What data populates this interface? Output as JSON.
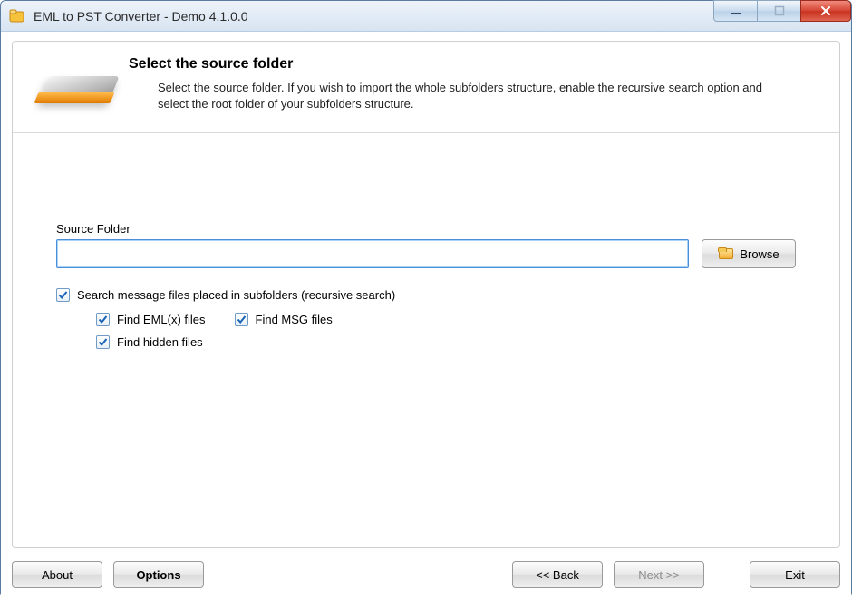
{
  "window": {
    "title": "EML to PST Converter - Demo 4.1.0.0"
  },
  "header": {
    "title": "Select the source folder",
    "description": "Select the source folder. If you wish to import the whole subfolders structure, enable the recursive search option and select the root folder of your subfolders structure."
  },
  "form": {
    "source_label": "Source Folder",
    "source_value": "",
    "browse_label": "Browse",
    "recursive_label": "Search message files placed in subfolders (recursive search)",
    "find_eml_label": "Find EML(x) files",
    "find_msg_label": "Find MSG files",
    "find_hidden_label": "Find hidden files",
    "recursive_checked": true,
    "find_eml_checked": true,
    "find_msg_checked": true,
    "find_hidden_checked": true
  },
  "footer": {
    "about_label": "About",
    "options_label": "Options",
    "back_label": "<< Back",
    "next_label": "Next >>",
    "exit_label": "Exit",
    "next_enabled": false
  }
}
